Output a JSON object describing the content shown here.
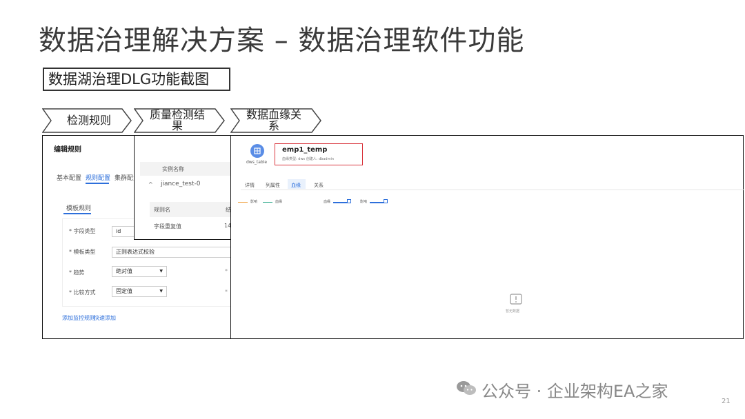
{
  "slide": {
    "title": "数据治理解决方案 – 数据治理软件功能",
    "subtitle": "数据湖治理DLG功能截图",
    "steps": [
      "检测规则",
      "质量检测结果",
      "数据血缘关系"
    ],
    "watermark": "公众号 · 企业架构EA之家",
    "page_number": "21"
  },
  "rule_editor": {
    "header": "编辑规则",
    "tabs": [
      "基本配置",
      "规则配置",
      "集群配置"
    ],
    "active_tab": "规则配置",
    "template_tab": "模板规则",
    "rows": [
      {
        "label": "* 字段类型",
        "value": "id"
      },
      {
        "label": "* 模板类型",
        "value": "正则表达式校验"
      },
      {
        "label": "* 趋势",
        "value": "绝对值"
      },
      {
        "label": "* 比较方式",
        "value": "固定值"
      }
    ],
    "links": [
      "添加监控规则",
      "快速添加"
    ]
  },
  "quality_result": {
    "column_header": "实例名称",
    "instance": "jiance_test-0",
    "sub_headers": [
      "规则名",
      "结"
    ],
    "rule_row": [
      "字段重复值",
      "14"
    ]
  },
  "lineage": {
    "table_type": "dws_table",
    "table_name": "emp1_temp",
    "meta": "血缘类型: dws     创建人: dbadmin",
    "tabs": [
      "详情",
      "列属性",
      "血缘",
      "关系"
    ],
    "active_tab": "血缘",
    "legend_left": [
      "影响",
      "血缘"
    ],
    "legend_right": [
      "血缘",
      "影响"
    ],
    "empty_text": "暂无数据"
  },
  "colors": {
    "accent": "#2d6fdb",
    "highlight_border": "#d9363e",
    "frame": "#111111"
  }
}
